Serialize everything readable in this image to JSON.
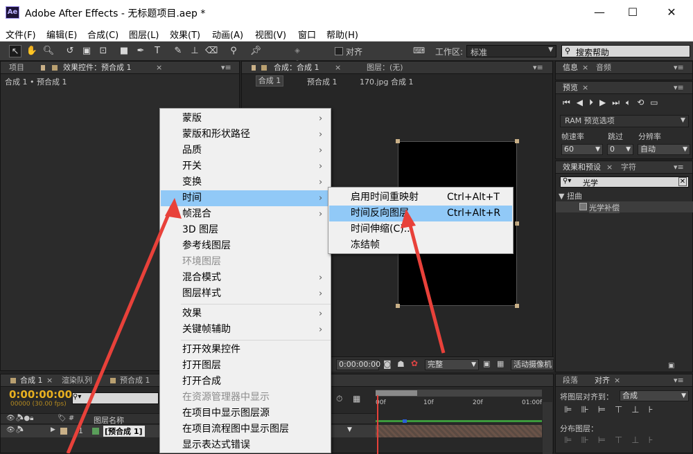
{
  "window": {
    "app_icon": "Ae",
    "title": "Adobe After Effects - 无标题项目.aep *",
    "min": "—",
    "max": "☐",
    "close": "✕"
  },
  "menubar": [
    "文件(F)",
    "编辑(E)",
    "合成(C)",
    "图层(L)",
    "效果(T)",
    "动画(A)",
    "视图(V)",
    "窗口",
    "帮助(H)"
  ],
  "toolbar": {
    "snap_label": "对齐",
    "workspace_label": "工作区:",
    "workspace_value": "标准",
    "search_help": "搜索帮助"
  },
  "left_panel": {
    "tab_project": "项目",
    "tab_effects": "效果控件：预合成 1",
    "breadcrumb": "合成 1 • 预合成 1"
  },
  "comp_panel": {
    "tab_comp": "合成：合成 1",
    "tab_layer": "图层：(无)",
    "crumbs": [
      "合成 1",
      "预合成 1",
      "170.jpg 合成 1"
    ],
    "timecode": "0:00:00:00",
    "quality": "完整",
    "camera": "活动摄像机"
  },
  "right_panels": {
    "info_tabs": [
      "信息",
      "音频"
    ],
    "preview_tab": "预览",
    "ram_option": "RAM 预览选项",
    "fps_label": "帧速率",
    "skip_label": "跳过",
    "res_label": "分辨率",
    "fps_value": "60",
    "skip_value": "0",
    "res_value": "自动",
    "effects_tabs": [
      "效果和预设",
      "字符"
    ],
    "effects_search": "光学",
    "effects_group": "扭曲",
    "effects_item": "光学补偿",
    "para_tabs": [
      "段落",
      "对齐"
    ],
    "align_label": "将图层对齐到：",
    "align_target": "合成",
    "distribute_label": "分布图层："
  },
  "timeline": {
    "tabs": [
      "合成 1",
      "渲染队列",
      "预合成 1"
    ],
    "timecode": "0:00:00:00",
    "fps_info": "00000 (30.00 fps)",
    "col_name": "图层名称",
    "layer_num": "1",
    "layer_name": "[预合成 1]",
    "ruler": [
      "00f",
      "10f",
      "20f",
      "01:00f"
    ]
  },
  "context_menu": {
    "items": [
      {
        "label": "蒙版",
        "sub": true
      },
      {
        "label": "蒙版和形状路径",
        "sub": true
      },
      {
        "label": "品质",
        "sub": true
      },
      {
        "label": "开关",
        "sub": true
      },
      {
        "label": "变换",
        "sub": true
      },
      {
        "label": "时间",
        "sub": true,
        "highlight": true
      },
      {
        "label": "帧混合",
        "sub": true
      },
      {
        "label": "3D 图层"
      },
      {
        "label": "参考线图层"
      },
      {
        "label": "环境图层",
        "disabled": true
      },
      {
        "label": "混合模式",
        "sub": true
      },
      {
        "label": "图层样式",
        "sub": true
      },
      {
        "label": "效果",
        "sub": true
      },
      {
        "label": "关键帧辅助",
        "sub": true
      },
      {
        "label": "打开效果控件"
      },
      {
        "label": "打开图层"
      },
      {
        "label": "打开合成"
      },
      {
        "label": "在资源管理器中显示",
        "disabled": true
      },
      {
        "label": "在项目中显示图层源"
      },
      {
        "label": "在项目流程图中显示图层"
      },
      {
        "label": "显示表达式错误"
      }
    ],
    "submenu": [
      {
        "label": "启用时间重映射",
        "shortcut": "Ctrl+Alt+T"
      },
      {
        "label": "时间反向图层",
        "shortcut": "Ctrl+Alt+R",
        "highlight": true
      },
      {
        "label": "时间伸缩(C)...",
        "shortcut": ""
      },
      {
        "label": "冻结帧",
        "shortcut": ""
      }
    ]
  },
  "colors": {
    "accent_red": "#e8413a",
    "highlight": "#91c9f7",
    "timecode": "#e8b020"
  }
}
